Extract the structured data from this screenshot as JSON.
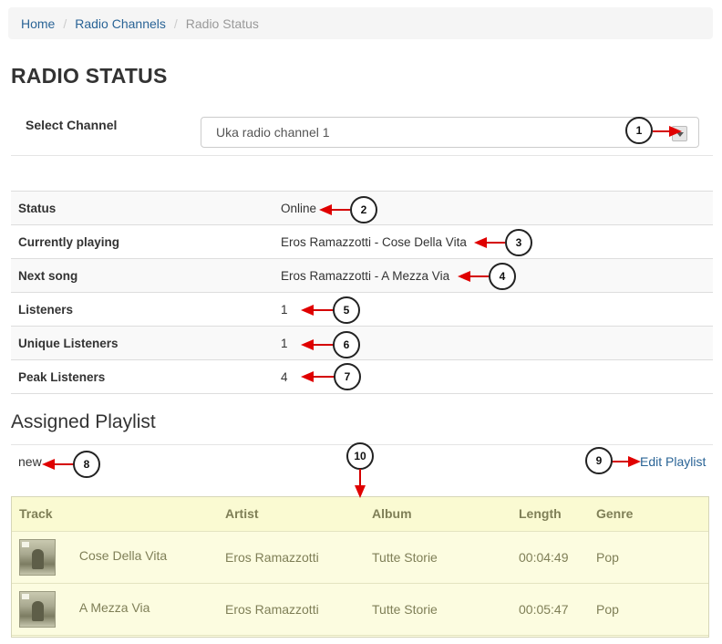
{
  "breadcrumb": [
    "Home",
    "Radio Channels",
    "Radio Status"
  ],
  "page_title": "RADIO STATUS",
  "channel_select": {
    "label": "Select Channel",
    "value": "Uka radio channel 1"
  },
  "status_rows": [
    {
      "label": "Status",
      "value": "Online"
    },
    {
      "label": "Currently playing",
      "value": "Eros Ramazzotti - Cose Della Vita"
    },
    {
      "label": "Next song",
      "value": "Eros Ramazzotti - A Mezza Via"
    },
    {
      "label": "Listeners",
      "value": "1"
    },
    {
      "label": "Unique Listeners",
      "value": "1"
    },
    {
      "label": "Peak Listeners",
      "value": "4"
    }
  ],
  "playlist": {
    "section_title": "Assigned Playlist",
    "name": "new",
    "edit_label": "Edit Playlist",
    "columns": [
      "Track",
      "Artist",
      "Album",
      "Length",
      "Genre"
    ],
    "tracks": [
      {
        "title": "Cose Della Vita",
        "artist": "Eros Ramazzotti",
        "album": "Tutte Storie",
        "length": "00:04:49",
        "genre": "Pop"
      },
      {
        "title": "A Mezza Via",
        "artist": "Eros Ramazzotti",
        "album": "Tutte Storie",
        "length": "00:05:47",
        "genre": "Pop"
      }
    ]
  },
  "callouts": [
    "1",
    "2",
    "3",
    "4",
    "5",
    "6",
    "7",
    "8",
    "9",
    "10"
  ],
  "colors": {
    "link": "#2a6496",
    "callout_arrow": "#e00000",
    "playlist_bg": "#fcfce0"
  }
}
